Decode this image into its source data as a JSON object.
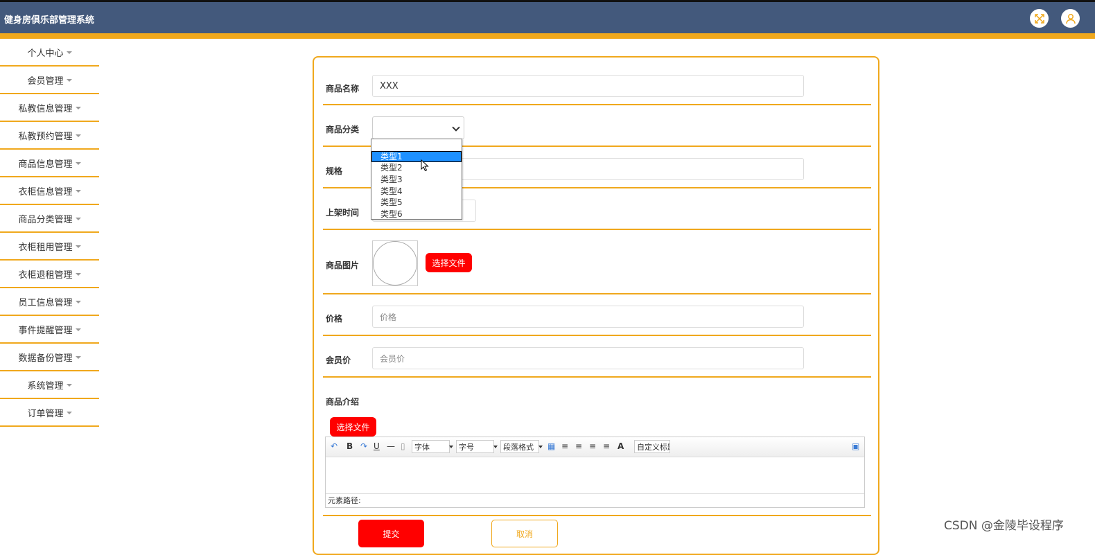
{
  "header": {
    "title": "健身房俱乐部管理系统",
    "icons": [
      "fullscreen-icon",
      "user-icon"
    ]
  },
  "sidebar": {
    "items": [
      {
        "label": "个人中心"
      },
      {
        "label": "会员管理"
      },
      {
        "label": "私教信息管理"
      },
      {
        "label": "私教预约管理"
      },
      {
        "label": "商品信息管理"
      },
      {
        "label": "衣柜信息管理"
      },
      {
        "label": "商品分类管理"
      },
      {
        "label": "衣柜租用管理"
      },
      {
        "label": "衣柜退租管理"
      },
      {
        "label": "员工信息管理"
      },
      {
        "label": "事件提醒管理"
      },
      {
        "label": "数据备份管理"
      },
      {
        "label": "系统管理"
      },
      {
        "label": "订单管理"
      }
    ]
  },
  "form": {
    "name_label": "商品名称",
    "name_value": "XXX",
    "category_label": "商品分类",
    "category_value": "",
    "category_options": [
      "",
      "类型1",
      "类型2",
      "类型3",
      "类型4",
      "类型5",
      "类型6"
    ],
    "category_selected": "类型1",
    "spec_label": "规格",
    "shelf_time_label": "上架时间",
    "image_label": "商品图片",
    "choose_file_label": "选择文件",
    "price_label": "价格",
    "price_placeholder": "价格",
    "member_price_label": "会员价",
    "member_price_placeholder": "会员价",
    "intro_label": "商品介绍",
    "intro_choose_file_label": "选择文件",
    "submit_label": "提交",
    "cancel_label": "取消"
  },
  "editor": {
    "bold": "B",
    "underline": "U",
    "font_family": "字体",
    "font_size": "字号",
    "paragraph": "段落格式",
    "custom_title": "自定义标题",
    "font_color": "A",
    "status_text": "元素路径:"
  },
  "watermark": "CSDN @金陵毕设程序",
  "colors": {
    "header": "#43597c",
    "accent": "#f0a81c",
    "button": "#ff0000",
    "selected": "#1e90ff"
  }
}
